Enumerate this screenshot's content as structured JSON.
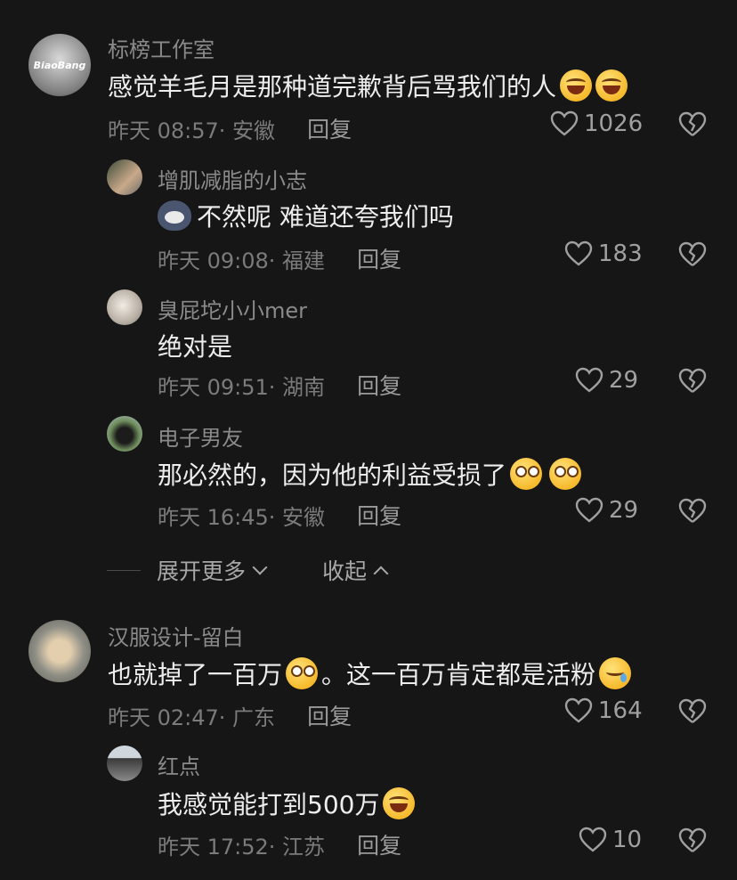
{
  "comments": [
    {
      "username": "标榜工作室",
      "avatar_text": "BiaoBang",
      "text": "感觉羊毛月是那种道完歉背后骂我们的人",
      "emojis": [
        "laugh",
        "laugh"
      ],
      "time": "昨天 08:57",
      "location": "· 安徽",
      "reply": "回复",
      "likes": "1026"
    },
    {
      "username": "增肌减脂的小志",
      "text": "不然呢 难道还夸我们吗",
      "time": "昨天 09:08",
      "location": "· 福建",
      "reply": "回复",
      "likes": "183"
    },
    {
      "username": "臭屁坨小小mer",
      "text": "绝对是",
      "time": "昨天 09:51",
      "location": "· 湖南",
      "reply": "回复",
      "likes": "29"
    },
    {
      "username": "电子男友",
      "text": "那必然的，因为他的利益受损了",
      "emojis": [
        "eye",
        "eye"
      ],
      "time": "昨天 16:45",
      "location": "· 安徽",
      "reply": "回复",
      "likes": "29"
    },
    {
      "username": "汉服设计-留白",
      "text_part1": "也就掉了一百万",
      "text_part2": "。这一百万肯定都是活粉",
      "time": "昨天 02:47",
      "location": "· 广东",
      "reply": "回复",
      "likes": "164"
    },
    {
      "username": "红点",
      "text": "我感觉能打到500万",
      "time": "昨天 17:52",
      "location": "· 江苏",
      "reply": "回复",
      "likes": "10"
    }
  ],
  "thread": {
    "expand_more": "展开更多",
    "collapse": "收起"
  },
  "colors": {
    "background": "#161616",
    "text_primary": "#ededed",
    "text_secondary": "#8a8a8a"
  }
}
